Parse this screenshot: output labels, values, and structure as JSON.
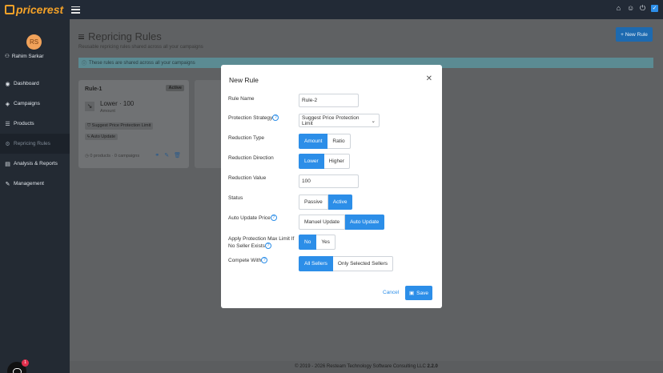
{
  "app": {
    "logo_text": "pricerest"
  },
  "topbar": {
    "icons": [
      "home-icon",
      "user-icon",
      "power-icon",
      "checkbox-icon"
    ]
  },
  "user": {
    "initials": "RS",
    "name": "Rahim Sarkar"
  },
  "sidebar": {
    "items": [
      {
        "label": "Dashboard",
        "icon": "dashboard-icon",
        "active": false
      },
      {
        "label": "Campaigns",
        "icon": "campaigns-icon",
        "active": false
      },
      {
        "label": "Products",
        "icon": "products-icon",
        "active": false
      },
      {
        "label": "Repricing Rules",
        "icon": "rules-icon",
        "active": true
      },
      {
        "label": "Analysis & Reports",
        "icon": "reports-icon",
        "active": false
      },
      {
        "label": "Management",
        "icon": "wrench-icon",
        "active": false
      }
    ]
  },
  "page": {
    "title": "Repricing Rules",
    "subtitle": "Reusable repricing rules shared across all your campaigns",
    "new_rule_label": "New Rule",
    "info_text": "These rules are shared across all your campaigns"
  },
  "rule_card": {
    "name": "Rule-1",
    "status": "Active",
    "value": "Lower · 100",
    "type": "Amount",
    "protection": "Suggest Price Protection Limit",
    "auto": "Auto Update",
    "footer": "0 products · 0 campaigns"
  },
  "modal": {
    "title": "New Rule",
    "rule_name_label": "Rule Name",
    "rule_name_value": "Rule-2",
    "protection_label": "Protection Strategy",
    "protection_value": "Suggest Price Protection Limit",
    "reduction_type_label": "Reduction Type",
    "reduction_type_options": [
      "Amount",
      "Ratio"
    ],
    "reduction_direction_label": "Reduction Direction",
    "reduction_direction_options": [
      "Lower",
      "Higher"
    ],
    "reduction_value_label": "Reduction Value",
    "reduction_value": "100",
    "status_label": "Status",
    "status_options": [
      "Passive",
      "Active"
    ],
    "auto_update_label": "Auto Update Price",
    "auto_update_options": [
      "Manuel Update",
      "Auto Update"
    ],
    "apply_protection_label_1": "Apply Protection Max Limit If",
    "apply_protection_label_2": "No Seller Exists",
    "apply_protection_options": [
      "No",
      "Yes"
    ],
    "compete_label": "Compete With",
    "compete_options": [
      "All Sellers",
      "Only Selected Sellers"
    ],
    "cancel_label": "Cancel",
    "save_label": "Save"
  },
  "footer": {
    "text": "© 2019 - 2026 Resteam Technology Software Consulting LLC",
    "version": "2.2.0"
  },
  "chat": {
    "badge": "1"
  },
  "colors": {
    "accent": "#2c8ee8",
    "sidebar": "#232a33",
    "topbar": "#222a36",
    "brand": "#f3a128"
  }
}
